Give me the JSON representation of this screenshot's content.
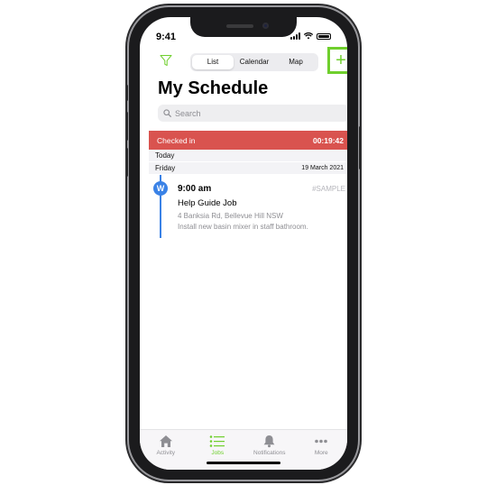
{
  "status_bar": {
    "time": "9:41"
  },
  "nav": {
    "segments": [
      "List",
      "Calendar",
      "Map"
    ],
    "active_segment": "List",
    "add_symbol": "+"
  },
  "page_title": "My Schedule",
  "search": {
    "placeholder": "Search"
  },
  "checkin": {
    "label": "Checked in",
    "timer": "00:19:42"
  },
  "sections": {
    "today": "Today",
    "friday": "Friday",
    "friday_date": "19 March 2021"
  },
  "job": {
    "avatar_letter": "W",
    "time": "9:00 am",
    "tag": "#SAMPLE",
    "title": "Help Guide Job",
    "address": "4 Banksia Rd, Bellevue Hill NSW",
    "description": "Install new basin mixer in staff bathroom."
  },
  "tabbar": {
    "items": [
      {
        "label": "Activity",
        "icon": "house-icon"
      },
      {
        "label": "Jobs",
        "icon": "list-icon"
      },
      {
        "label": "Notifications",
        "icon": "bell-icon"
      },
      {
        "label": "More",
        "icon": "more-dots-icon"
      }
    ],
    "active": "Jobs"
  },
  "colors": {
    "accent": "#6fcf2d",
    "checkin": "#d9534f",
    "timeline": "#3a82e6"
  }
}
